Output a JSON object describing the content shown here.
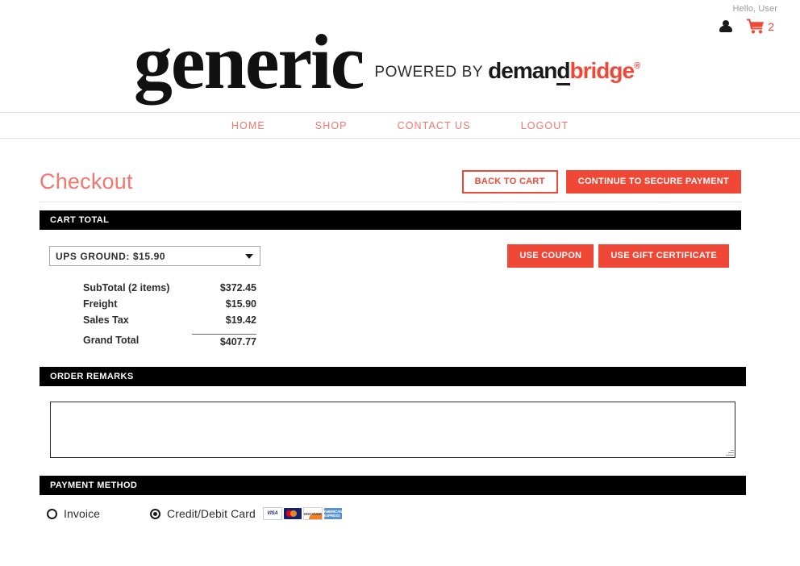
{
  "utility": {
    "greeting": "Hello, User",
    "account_icon": "person-icon",
    "cart_icon": "shopping-cart-icon",
    "cart_count": "2"
  },
  "logo": {
    "brand": "generic",
    "powered_by": "POWERED BY",
    "partner_first": "deman",
    "partner_first_underlined": "d",
    "partner_second": "bridge",
    "registered": "®"
  },
  "nav": {
    "items": [
      {
        "label": "HOME"
      },
      {
        "label": "SHOP"
      },
      {
        "label": "CONTACT US"
      },
      {
        "label": "LOGOUT"
      }
    ]
  },
  "page": {
    "title": "Checkout",
    "back_to_cart": "BACK TO CART",
    "continue_payment": "CONTINUE TO SECURE PAYMENT"
  },
  "cart_total": {
    "section_title": "CART TOTAL",
    "shipping_select": {
      "value": "UPS GROUND: $15.90",
      "caret_icon": "chevron-down-icon"
    },
    "use_coupon": "USE COUPON",
    "use_gift_certificate": "USE GIFT CERTIFICATE",
    "rows": [
      {
        "label": "SubTotal (2 items)",
        "value": "$372.45"
      },
      {
        "label": "Freight",
        "value": "$15.90"
      },
      {
        "label": "Sales Tax",
        "value": "$19.42"
      }
    ],
    "grand_total": {
      "label": "Grand Total",
      "value": "$407.77"
    }
  },
  "order_remarks": {
    "section_title": "ORDER REMARKS",
    "value": "",
    "placeholder": ""
  },
  "payment_method": {
    "section_title": "PAYMENT METHOD",
    "options": [
      {
        "label": "Invoice",
        "selected": false
      },
      {
        "label": "Credit/Debit Card",
        "selected": true
      }
    ],
    "cards": [
      {
        "name": "visa-card-logo",
        "text": "VISA"
      },
      {
        "name": "mastercard-card-logo",
        "text": ""
      },
      {
        "name": "discover-card-logo",
        "text": "DISCOVER"
      },
      {
        "name": "amex-card-logo",
        "text": "AMERICAN EXPRESS"
      }
    ]
  },
  "colors": {
    "accent_red": "#ef4836",
    "accent_light_red": "#f4766c",
    "section_bar": "#000000"
  }
}
